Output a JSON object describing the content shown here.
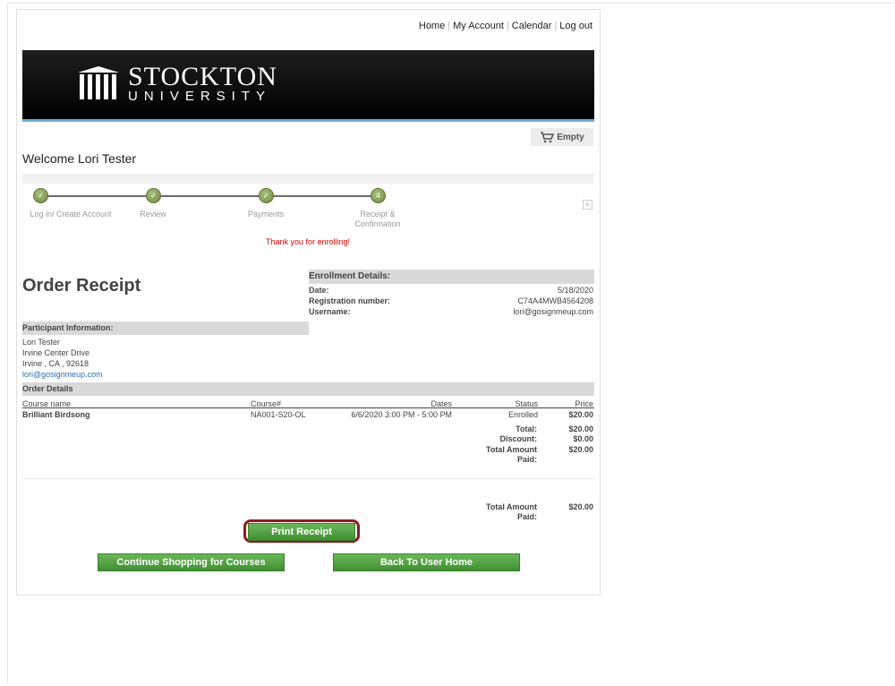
{
  "nav": {
    "home": "Home",
    "my_account": "My Account",
    "calendar": "Calendar",
    "logout": "Log out"
  },
  "logo": {
    "line1": "STOCKTON",
    "line2": "UNIVERSITY"
  },
  "cart": {
    "label": "Empty",
    "icon": "cart-icon"
  },
  "welcome": "Welcome Lori Tester",
  "steps": [
    {
      "label": "Log in/ Create Account",
      "mark": "✓"
    },
    {
      "label": "Review",
      "mark": "✓"
    },
    {
      "label": "Payments",
      "mark": "✓"
    },
    {
      "label": "Receipt & Confirmation",
      "mark": "4"
    }
  ],
  "close_mark": "×",
  "thanks": "Thank you for enrolling!",
  "order_title": "Order Receipt",
  "enrollment": {
    "heading": "Enrollment Details:",
    "date_label": "Date:",
    "date": "5/18/2020",
    "reg_label": "Registration number:",
    "reg": "C74A4MWB4564208",
    "user_label": "Username:",
    "user": "lori@gosignmeup.com"
  },
  "participant": {
    "heading": "Participant Information:",
    "name": "Lori Tester",
    "street": "Irvine Center Drive",
    "city": "Irvine , CA , 92618",
    "email": "lori@gosignmeup.com"
  },
  "order": {
    "heading": "Order Details",
    "columns": [
      "Course name",
      "Course#",
      "Dates",
      "Status",
      "Price"
    ],
    "row": {
      "name": "Brilliant Birdsong",
      "number": "NA001-S20-OL",
      "dates": "6/6/2020 3:00 PM - 5:00 PM",
      "status": "Enrolled",
      "price": "$20.00"
    },
    "total_label": "Total:",
    "total": "$20.00",
    "discount_label": "Discount:",
    "discount": "$0.00",
    "paid_label_1": "Total Amount",
    "paid_label_2": "Paid:",
    "paid": "$20.00",
    "paid2_label_1": "Total Amount",
    "paid2_label_2": "Paid:",
    "paid2": "$20.00"
  },
  "buttons": {
    "print": "Print Receipt",
    "continue": "Continue Shopping for Courses",
    "back": "Back To User Home"
  },
  "colors": {
    "accent_green": "#4f9f3f",
    "highlight": "#8b1b1b",
    "alert_red": "#e00000",
    "link_blue": "#2c6eb5"
  }
}
